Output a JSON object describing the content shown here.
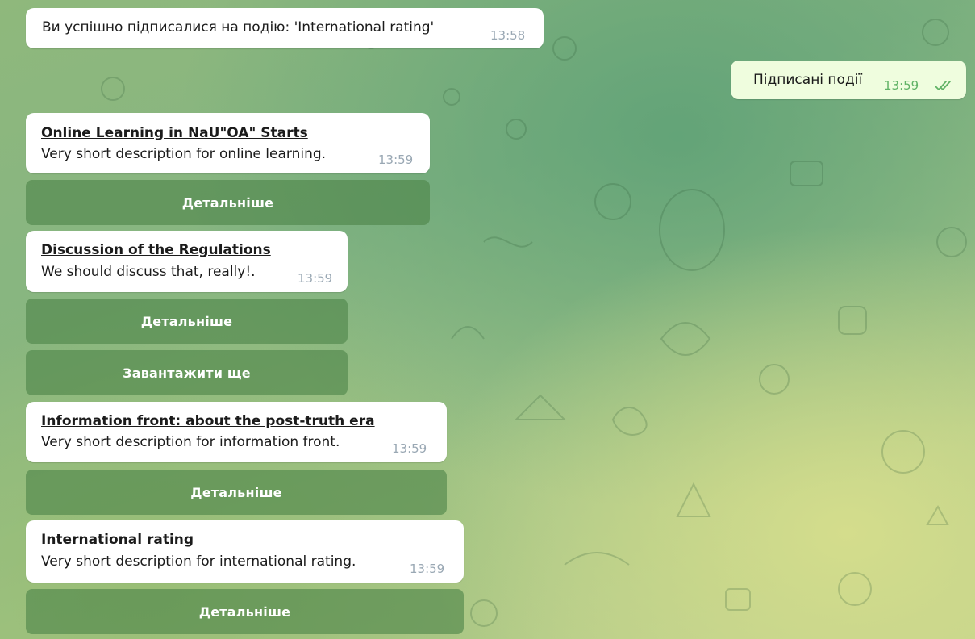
{
  "messages": {
    "subscribed": {
      "text": "Ви успішно підписалися на подію: 'International rating'",
      "time": "13:58"
    },
    "user_command": {
      "text": "Підписані події",
      "time": "13:59",
      "status": "read-double-check"
    },
    "events": [
      {
        "title": "Online Learning in NaU\"OA\" Starts",
        "description": "Very short description for online learning.",
        "time": "13:59",
        "button": "Детальніше"
      },
      {
        "title": "Discussion of the Regulations",
        "description": "We should discuss that, really!.",
        "time": "13:59",
        "button": "Детальніше",
        "extra_button": "Завантажити ще"
      },
      {
        "title": "Information front: about the post-truth era",
        "description": "Very short description for information front.",
        "time": "13:59",
        "button": "Детальніше"
      },
      {
        "title": "International rating",
        "description": "Very short description for international rating.",
        "time": "13:59",
        "button": "Детальніше"
      }
    ]
  },
  "colors": {
    "bubble_in": "#ffffff",
    "bubble_out": "#effdde",
    "inline_button": "#4e8448",
    "read_check": "#61b366"
  }
}
